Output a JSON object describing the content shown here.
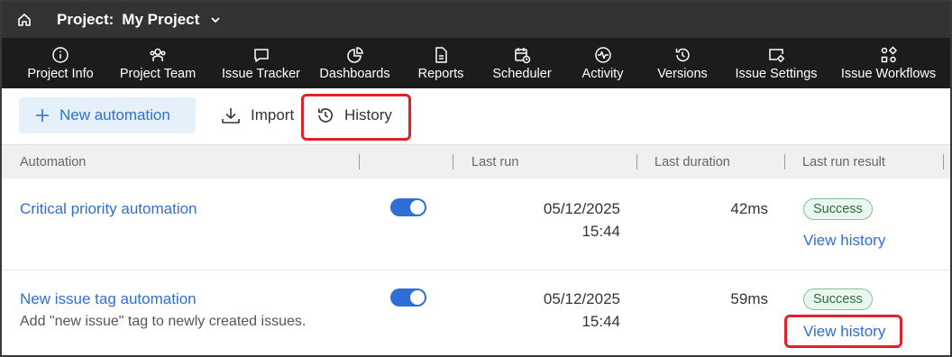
{
  "titlebar": {
    "project_label": "Project:",
    "project_name": "My Project"
  },
  "nav": {
    "items": [
      {
        "label": "Project Info",
        "icon": "info-icon"
      },
      {
        "label": "Project Team",
        "icon": "team-icon"
      },
      {
        "label": "Issue Tracker",
        "icon": "chat-bubble-icon"
      },
      {
        "label": "Dashboards",
        "icon": "pie-chart-icon"
      },
      {
        "label": "Reports",
        "icon": "document-icon"
      },
      {
        "label": "Scheduler",
        "icon": "calendar-clock-icon"
      },
      {
        "label": "Activity",
        "icon": "pulse-icon"
      },
      {
        "label": "Versions",
        "icon": "history-icon"
      },
      {
        "label": "Issue Settings",
        "icon": "settings-window-icon"
      },
      {
        "label": "Issue Workflows",
        "icon": "workflow-icon"
      }
    ]
  },
  "toolbar": {
    "new_automation_label": "New automation",
    "import_label": "Import",
    "history_label": "History"
  },
  "table": {
    "headers": {
      "automation": "Automation",
      "last_run": "Last run",
      "last_duration": "Last duration",
      "last_run_result": "Last run result"
    },
    "rows": [
      {
        "name": "Critical priority automation",
        "description": "",
        "enabled": true,
        "last_run_date": "05/12/2025",
        "last_run_time": "15:44",
        "last_duration": "42ms",
        "result": "Success",
        "view_history": "View history"
      },
      {
        "name": "New issue tag automation",
        "description": "Add \"new issue\" tag to newly created issues.",
        "enabled": true,
        "last_run_date": "05/12/2025",
        "last_run_time": "15:44",
        "last_duration": "59ms",
        "result": "Success",
        "view_history": "View history"
      }
    ]
  },
  "colors": {
    "accent": "#2e6fd6",
    "highlight": "#e2202a",
    "success_bg": "#eaf7ef",
    "success_border": "#7cc49a"
  }
}
